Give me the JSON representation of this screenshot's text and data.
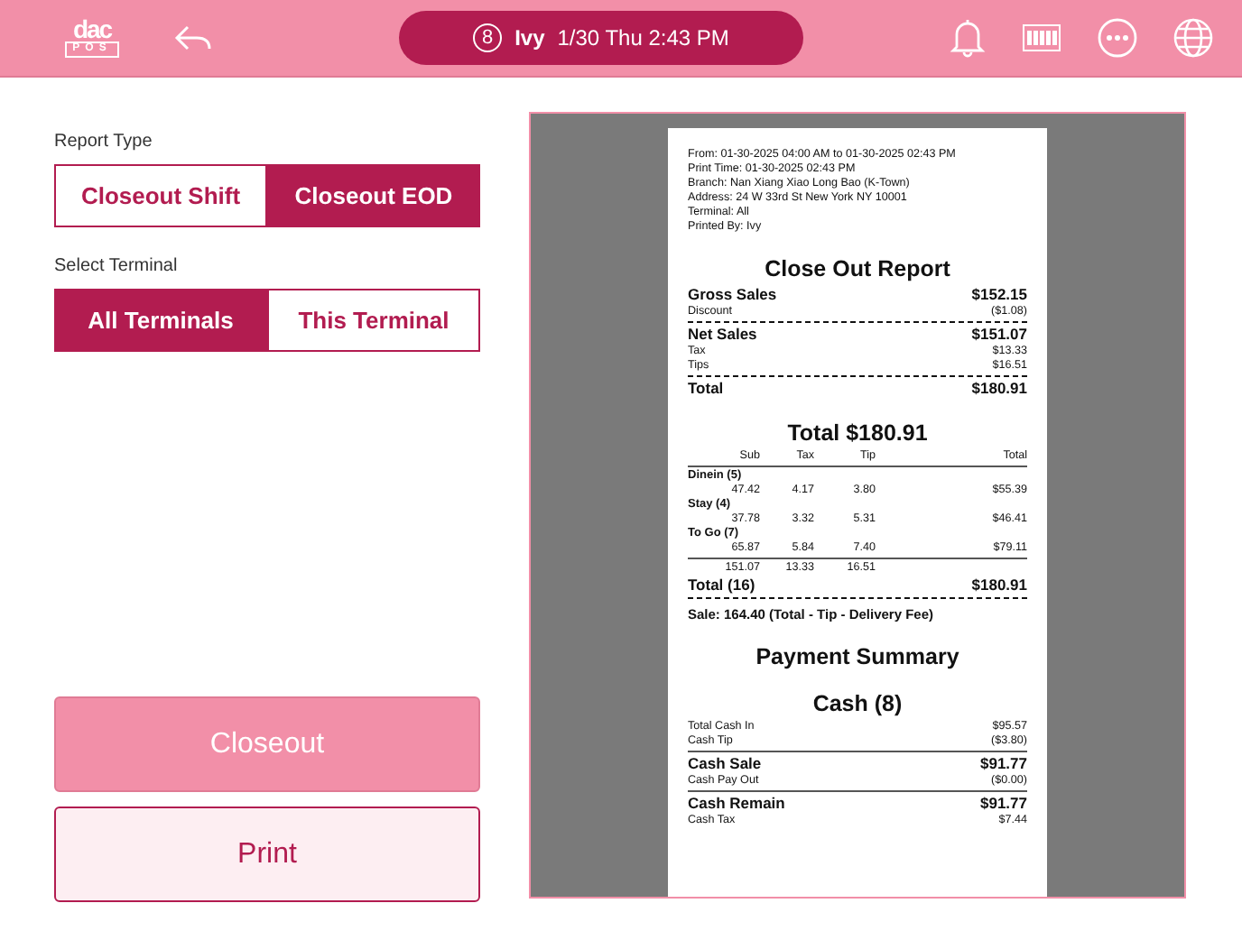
{
  "header": {
    "logo": {
      "top": "dac",
      "bottom": "POS"
    },
    "user_badge": "8",
    "user": "Ivy",
    "datetime": "1/30 Thu 2:43 PM"
  },
  "report_type": {
    "label": "Report Type",
    "options": [
      {
        "label": "Closeout Shift",
        "selected": false
      },
      {
        "label": "Closeout EOD",
        "selected": true
      }
    ]
  },
  "terminal": {
    "label": "Select Terminal",
    "options": [
      {
        "label": "All Terminals",
        "selected": true
      },
      {
        "label": "This Terminal",
        "selected": false
      }
    ]
  },
  "actions": [
    {
      "label": "Closeout",
      "kind": "primary"
    },
    {
      "label": "Print",
      "kind": "secondary"
    }
  ],
  "receipt": [
    {
      "kind": "info",
      "text": "From: 01-30-2025 04:00 AM to 01-30-2025 02:43 PM"
    },
    {
      "kind": "info",
      "text": "Print Time: 01-30-2025 02:43 PM"
    },
    {
      "kind": "info",
      "text": "Branch: Nan Xiang Xiao Long Bao (K-Town)"
    },
    {
      "kind": "info",
      "text": "Address: 24 W 33rd St New York NY 10001"
    },
    {
      "kind": "info",
      "text": "Terminal: All"
    },
    {
      "kind": "info",
      "text": "Printed By: Ivy"
    },
    {
      "kind": "title",
      "text": "Close Out Report"
    },
    {
      "kind": "major",
      "label": "Gross Sales",
      "value": "$152.15"
    },
    {
      "kind": "minor",
      "label": "Discount",
      "value": "($1.08)"
    },
    {
      "kind": "dashed"
    },
    {
      "kind": "major",
      "label": "Net Sales",
      "value": "$151.07"
    },
    {
      "kind": "minor",
      "label": "Tax",
      "value": "$13.33"
    },
    {
      "kind": "minor",
      "label": "Tips",
      "value": "$16.51"
    },
    {
      "kind": "dashed"
    },
    {
      "kind": "major",
      "label": "Total",
      "value": "$180.91"
    },
    {
      "kind": "title",
      "text": "Total $180.91"
    },
    {
      "kind": "columns",
      "cells": [
        "Sub",
        "Tax",
        "Tip",
        "Total"
      ]
    },
    {
      "kind": "solid"
    },
    {
      "kind": "group",
      "text": "Dinein (5)"
    },
    {
      "kind": "columns",
      "cells": [
        "47.42",
        "4.17",
        "3.80",
        "$55.39"
      ]
    },
    {
      "kind": "group",
      "text": "Stay (4)"
    },
    {
      "kind": "columns",
      "cells": [
        "37.78",
        "3.32",
        "5.31",
        "$46.41"
      ]
    },
    {
      "kind": "group",
      "text": "To Go (7)"
    },
    {
      "kind": "columns",
      "cells": [
        "65.87",
        "5.84",
        "7.40",
        "$79.11"
      ]
    },
    {
      "kind": "solid"
    },
    {
      "kind": "columns",
      "cells": [
        "151.07",
        "13.33",
        "16.51",
        ""
      ]
    },
    {
      "kind": "major",
      "label": "Total (16)",
      "value": "$180.91"
    },
    {
      "kind": "dashed"
    },
    {
      "kind": "note",
      "text": "Sale: 164.40 (Total - Tip - Delivery Fee)"
    },
    {
      "kind": "title",
      "text": "Payment Summary"
    },
    {
      "kind": "title",
      "text": "Cash (8)"
    },
    {
      "kind": "minor",
      "label": "Total Cash In",
      "value": "$95.57"
    },
    {
      "kind": "minor",
      "label": "Cash Tip",
      "value": "($3.80)"
    },
    {
      "kind": "solid"
    },
    {
      "kind": "major",
      "label": "Cash Sale",
      "value": "$91.77"
    },
    {
      "kind": "minor",
      "label": "Cash Pay Out",
      "value": "($0.00)"
    },
    {
      "kind": "solid"
    },
    {
      "kind": "major",
      "label": "Cash Remain",
      "value": "$91.77"
    },
    {
      "kind": "minor",
      "label": "Cash Tax",
      "value": "$7.44"
    }
  ]
}
